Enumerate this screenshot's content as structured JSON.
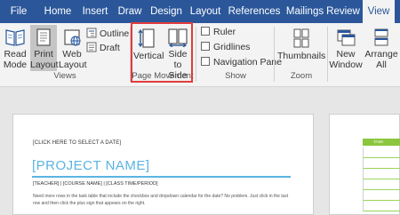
{
  "tabs": [
    {
      "label": "File"
    },
    {
      "label": "Home"
    },
    {
      "label": "Insert"
    },
    {
      "label": "Draw"
    },
    {
      "label": "Design"
    },
    {
      "label": "Layout"
    },
    {
      "label": "References"
    },
    {
      "label": "Mailings"
    },
    {
      "label": "Review"
    },
    {
      "label": "View"
    }
  ],
  "ribbon": {
    "views": {
      "read_mode": [
        "Read",
        "Mode"
      ],
      "print_layout": [
        "Print",
        "Layout"
      ],
      "web_layout": [
        "Web",
        "Layout"
      ],
      "outline": "Outline",
      "draft": "Draft",
      "group": "Views"
    },
    "page_movement": {
      "vertical": "Vertical",
      "side_to_side": [
        "Side",
        "to Side"
      ],
      "group": "Page Movement"
    },
    "show": {
      "ruler": "Ruler",
      "gridlines": "Gridlines",
      "navigation_pane": "Navigation Pane",
      "group": "Show"
    },
    "zoom": {
      "thumbnails": "Thumbnails",
      "group": "Zoom"
    },
    "window": {
      "new_window": [
        "New",
        "Window"
      ],
      "arrange_all": [
        "Arrange",
        "All"
      ]
    }
  },
  "document": {
    "date": "[CLICK HERE TO SELECT A DATE]",
    "project_name": "[PROJECT NAME]",
    "meta": "[TEACHER]  |  [COURSE NAME]  |  [CLASS TIME/PERIOD]",
    "paragraph": "Need more rows in the task table that include the checkbox and dropdown calendar for the date? No problem. Just click in the last row and then click the plus sign that appears on the right.",
    "task_header": "TASK"
  },
  "colors": {
    "tab_bar": "#2b579a",
    "highlight_box": "#e03c3c",
    "project_name": "#5ab3e3",
    "task_header": "#8cc63f"
  }
}
